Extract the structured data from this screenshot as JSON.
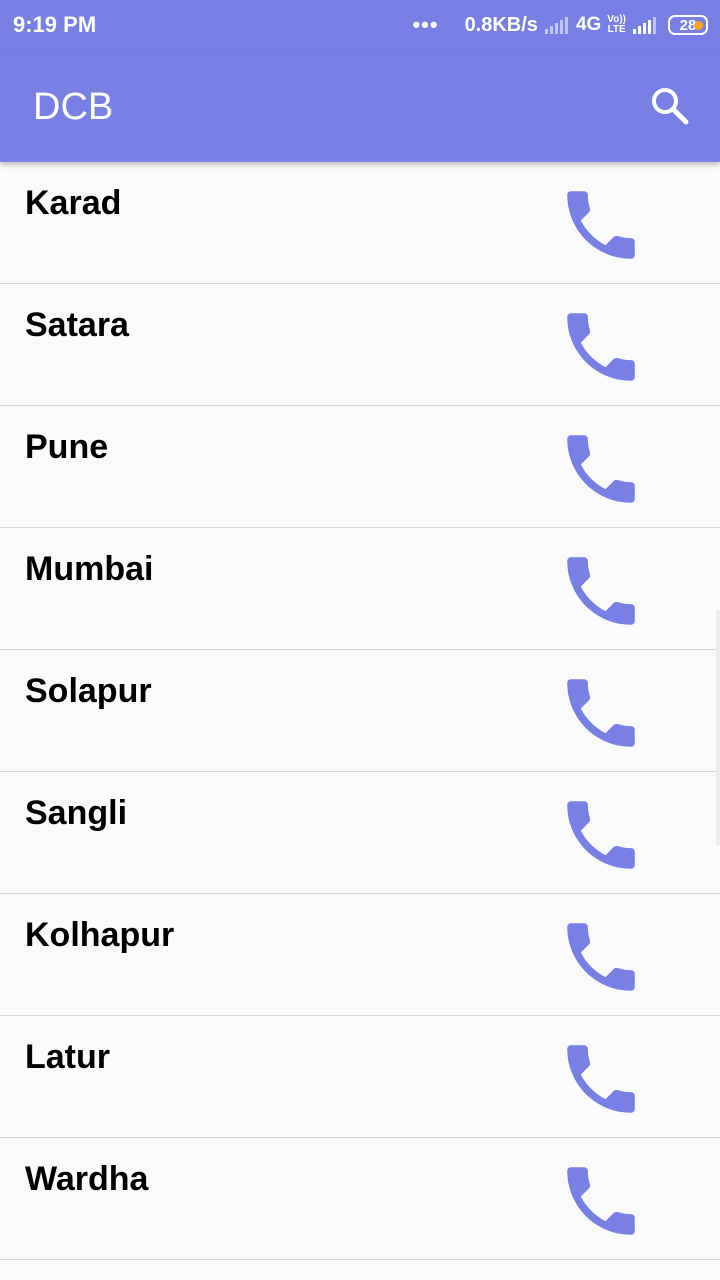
{
  "status_bar": {
    "time": "9:19 PM",
    "more_indicator": "•••",
    "net_speed": "0.8KB/s",
    "net_type": "4G",
    "volte_top": "Vo))",
    "volte_bottom": "LTE",
    "battery": "28",
    "battery_dot_color": "#f5a623",
    "icons": [
      "signal-icon",
      "signal-icon",
      "battery-icon"
    ]
  },
  "app_bar": {
    "title": "DCB",
    "search_icon": "search-icon",
    "color": "#7880e6"
  },
  "list": {
    "items": [
      {
        "label": "Karad",
        "icon": "phone-icon"
      },
      {
        "label": "Satara",
        "icon": "phone-icon"
      },
      {
        "label": "Pune",
        "icon": "phone-icon"
      },
      {
        "label": "Mumbai",
        "icon": "phone-icon"
      },
      {
        "label": "Solapur",
        "icon": "phone-icon"
      },
      {
        "label": "Sangli",
        "icon": "phone-icon"
      },
      {
        "label": "Kolhapur",
        "icon": "phone-icon"
      },
      {
        "label": "Latur",
        "icon": "phone-icon"
      },
      {
        "label": "Wardha",
        "icon": "phone-icon"
      }
    ]
  },
  "colors": {
    "accent": "#7880e6",
    "background": "#fafafa",
    "divider": "#d6d6d6"
  }
}
